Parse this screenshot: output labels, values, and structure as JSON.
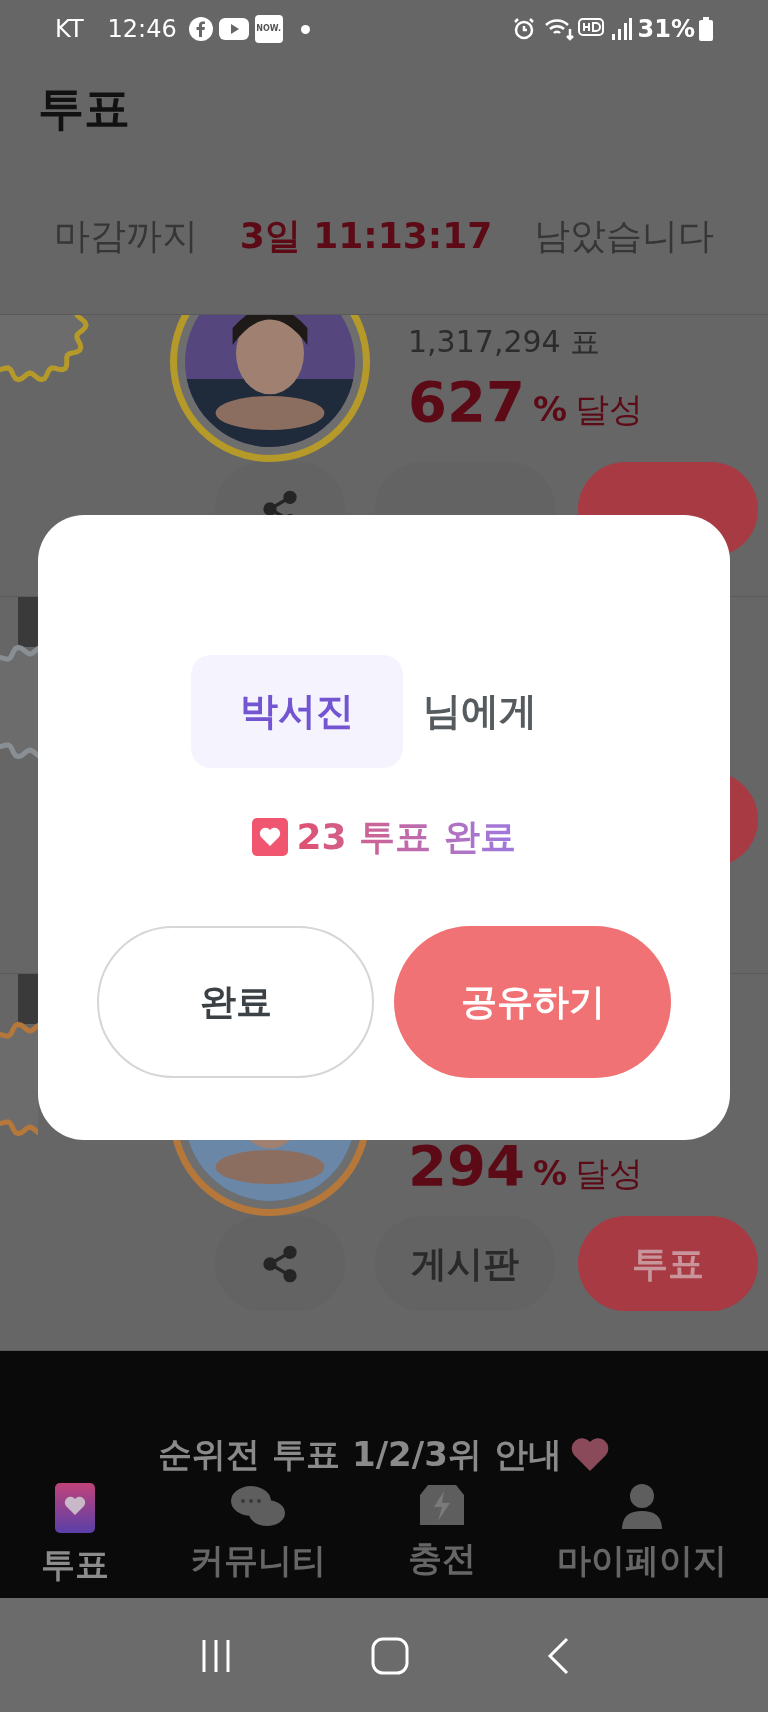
{
  "status_bar": {
    "carrier": "KT",
    "time": "12:46",
    "app_badge": "NOW.",
    "battery": "31%"
  },
  "header": {
    "title": "투표"
  },
  "countdown": {
    "prefix": "마감까지",
    "remaining": "3일 11:13:17",
    "suffix": "남았습니다"
  },
  "candidates": [
    {
      "color": "#b59a2a",
      "votes": "1,317,294 표",
      "percent": "627",
      "unit": "%",
      "achieved": "달성"
    },
    {
      "color": "#8a8f93"
    },
    {
      "color": "#b5773a",
      "percent": "294",
      "unit": "%",
      "achieved": "달성",
      "board": "게시판",
      "vote": "투표"
    }
  ],
  "banner": {
    "title": "순위전 투표 1/2/3위 안내"
  },
  "nav": [
    {
      "kind": "vote",
      "label": "투표",
      "selected": true
    },
    {
      "kind": "community",
      "label": "커뮤니티",
      "selected": false
    },
    {
      "kind": "charge",
      "label": "충전",
      "selected": false
    },
    {
      "kind": "profile",
      "label": "마이페이지",
      "selected": false
    }
  ],
  "dialog": {
    "name": "박서진",
    "suffix": "님에게",
    "result": "23 투표 완료",
    "buttons": [
      {
        "kind": "secondary",
        "label": "완료"
      },
      {
        "kind": "primary",
        "label": "공유하기"
      }
    ]
  }
}
